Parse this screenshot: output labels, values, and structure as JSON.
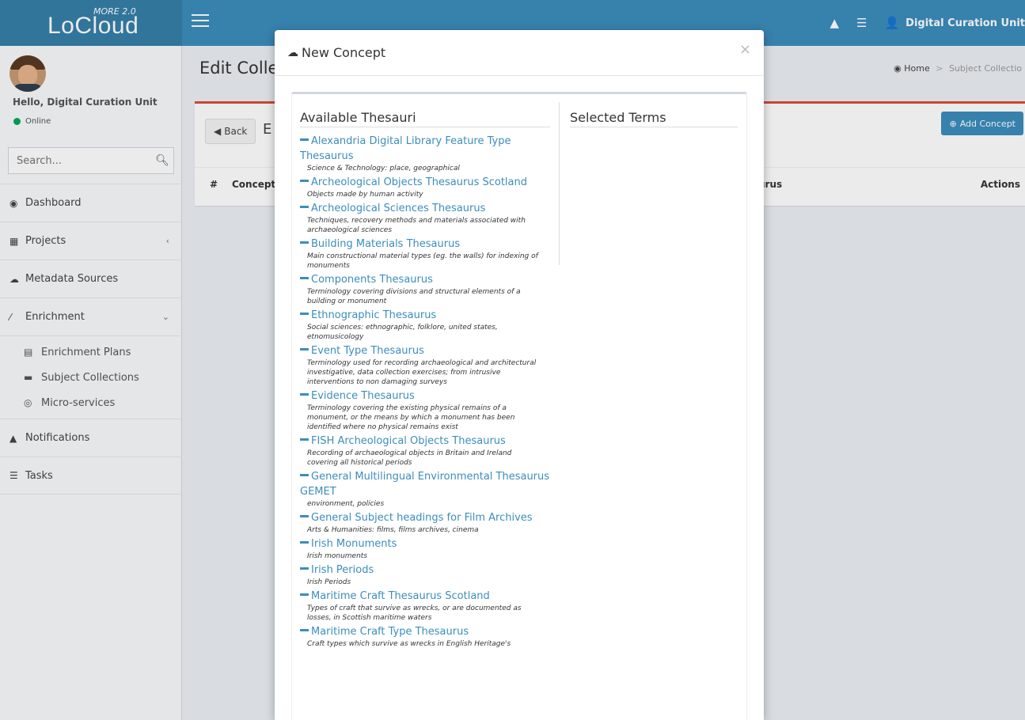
{
  "header": {
    "logo_tag": "MORE 2.0",
    "logo_text": "LoCloud",
    "user_name": "Digital Curation Unit",
    "icons": [
      "menu-icon",
      "warning-icon",
      "tasks-icon",
      "user-icon"
    ]
  },
  "sidebar": {
    "greeting": "Hello, Digital Curation Unit",
    "status": "Online",
    "search_placeholder": "Search...",
    "items": [
      {
        "label": "Dashboard",
        "icon": "dashboard-icon"
      },
      {
        "label": "Projects",
        "icon": "table-icon"
      },
      {
        "label": "Metadata Sources",
        "icon": "cloud-icon"
      },
      {
        "label": "Enrichment",
        "icon": "magic-wand-icon"
      },
      {
        "label": "Notifications",
        "icon": "warning-icon"
      },
      {
        "label": "Tasks",
        "icon": "tasks-icon"
      }
    ],
    "sub_items": [
      {
        "label": "Enrichment Plans",
        "icon": "file-icon"
      },
      {
        "label": "Subject Collections",
        "icon": "archive-icon"
      },
      {
        "label": "Micro-services",
        "icon": "bullseye-icon"
      }
    ]
  },
  "content": {
    "title": "Edit Colle",
    "breadcrumb_home": "Home",
    "breadcrumb_current": "Subject Collectio",
    "back_label": "Back",
    "box_title": "E",
    "add_concept_label": "Add Concept",
    "table_headers": {
      "hash": "#",
      "concept": "Concept",
      "thesaurus": "urus",
      "actions": "Actions"
    }
  },
  "modal": {
    "title": "New Concept",
    "close": "×",
    "available_heading": "Available Thesauri",
    "selected_heading": "Selected Terms",
    "thesauri": [
      {
        "name": "Alexandria Digital Library Feature Type Thesaurus",
        "desc": "Science & Technology: place, geographical"
      },
      {
        "name": "Archeological Objects Thesaurus Scotland",
        "desc": "Objects made by human activity"
      },
      {
        "name": "Archeological Sciences Thesaurus",
        "desc": "Techniques, recovery methods and materials associated with archaeological sciences"
      },
      {
        "name": "Building Materials Thesaurus",
        "desc": "Main constructional material types (eg. the walls) for indexing of monuments"
      },
      {
        "name": "Components Thesaurus",
        "desc": "Terminology covering divisions and structural elements of a building or monument"
      },
      {
        "name": "Ethnographic Thesaurus",
        "desc": "Social sciences: ethnographic, folklore, united states, etnomusicology"
      },
      {
        "name": "Event Type Thesaurus",
        "desc": "Terminology used for recording archaeological and architectural investigative, data collection exercises; from intrusive interventions to non damaging surveys"
      },
      {
        "name": "Evidence Thesaurus",
        "desc": "Terminology covering the existing physical remains of a monument, or the means by which a monument has been identified where no physical remains exist"
      },
      {
        "name": "FISH Archeological Objects Thesaurus",
        "desc": "Recording of archaeological objects in Britain and Ireland covering all historical periods"
      },
      {
        "name": "General Multilingual Environmental Thesaurus GEMET",
        "desc": "environment, policies"
      },
      {
        "name": "General Subject headings for Film Archives",
        "desc": "Arts & Humanities: films, films archives, cinema"
      },
      {
        "name": "Irish Monuments",
        "desc": "Irish monuments"
      },
      {
        "name": "Irish Periods",
        "desc": "Irish Periods"
      },
      {
        "name": "Maritime Craft Thesaurus Scotland",
        "desc": "Types of craft that survive as wrecks, or are documented as losses, in Scottish maritime waters"
      },
      {
        "name": "Maritime Craft Type Thesaurus",
        "desc": "Craft types which survive as wrecks in English Heritage's"
      }
    ]
  }
}
